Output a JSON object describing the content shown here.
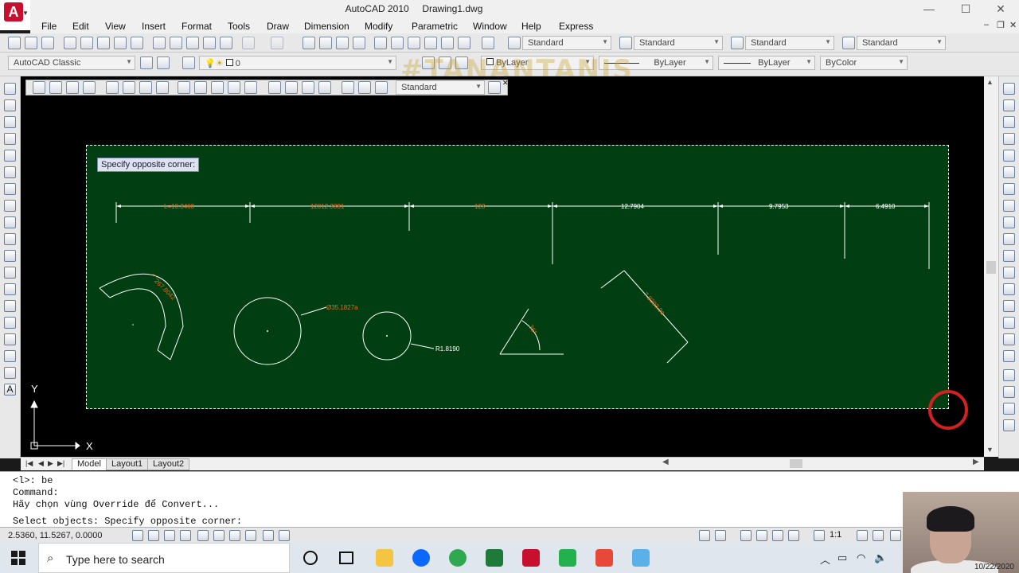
{
  "app": {
    "title": "AutoCAD 2010",
    "document": "Drawing1.dwg",
    "logo_letter": "A"
  },
  "window_buttons": {
    "minimize": "—",
    "maximize": "☐",
    "close": "✕"
  },
  "menu": {
    "items": [
      "File",
      "Edit",
      "View",
      "Insert",
      "Format",
      "Tools",
      "Draw",
      "Dimension",
      "Modify",
      "Parametric",
      "Window",
      "Help",
      "Express"
    ],
    "mdi_minimize": "–",
    "mdi_restore": "❐",
    "mdi_close": "✕"
  },
  "styles_toolbar": {
    "text_style": "Standard",
    "dim_style": "Standard",
    "table_style": "Standard",
    "mleader_style": "Standard"
  },
  "workspace_toolbar": {
    "workspace": "AutoCAD Classic",
    "layer": "0",
    "color": "ByLayer",
    "linetype": "ByLayer",
    "lineweight": "ByLayer",
    "plotstyle": "ByColor"
  },
  "watermark": "#TANANTANIS",
  "dimension_toolbar": {
    "dim_style": "Standard"
  },
  "tooltip": "Specify opposite corner:",
  "dimensions": {
    "d1": "L=10.3460",
    "d2": "12012.3381",
    "d3": "123",
    "d4": "12.7904",
    "d5": "9.7953",
    "d6": "6.4910",
    "arc": "⌒267.8042",
    "diameter": "Ø35.1827a",
    "radius": "R1.8190",
    "angle": "36°",
    "aligned": "7.9393.9a"
  },
  "ucs": {
    "x": "X",
    "y": "Y"
  },
  "layout_tabs": [
    "Model",
    "Layout1",
    "Layout2"
  ],
  "command": {
    "line1": "<l>: be",
    "line2": "Command:",
    "line3": "Hãy chọn vùng Override để Convert...",
    "line4": "Select objects: Specify opposite corner:"
  },
  "status": {
    "coords": "2.5360, 11.5267, 0.0000",
    "scale": "1:1"
  },
  "taskbar": {
    "search_placeholder": "Type here to search",
    "date": "10/22/2020"
  },
  "colors": {
    "selection_fill": "#013f12",
    "dim_text_red": "#e06a18",
    "line_white": "#ffffff"
  }
}
